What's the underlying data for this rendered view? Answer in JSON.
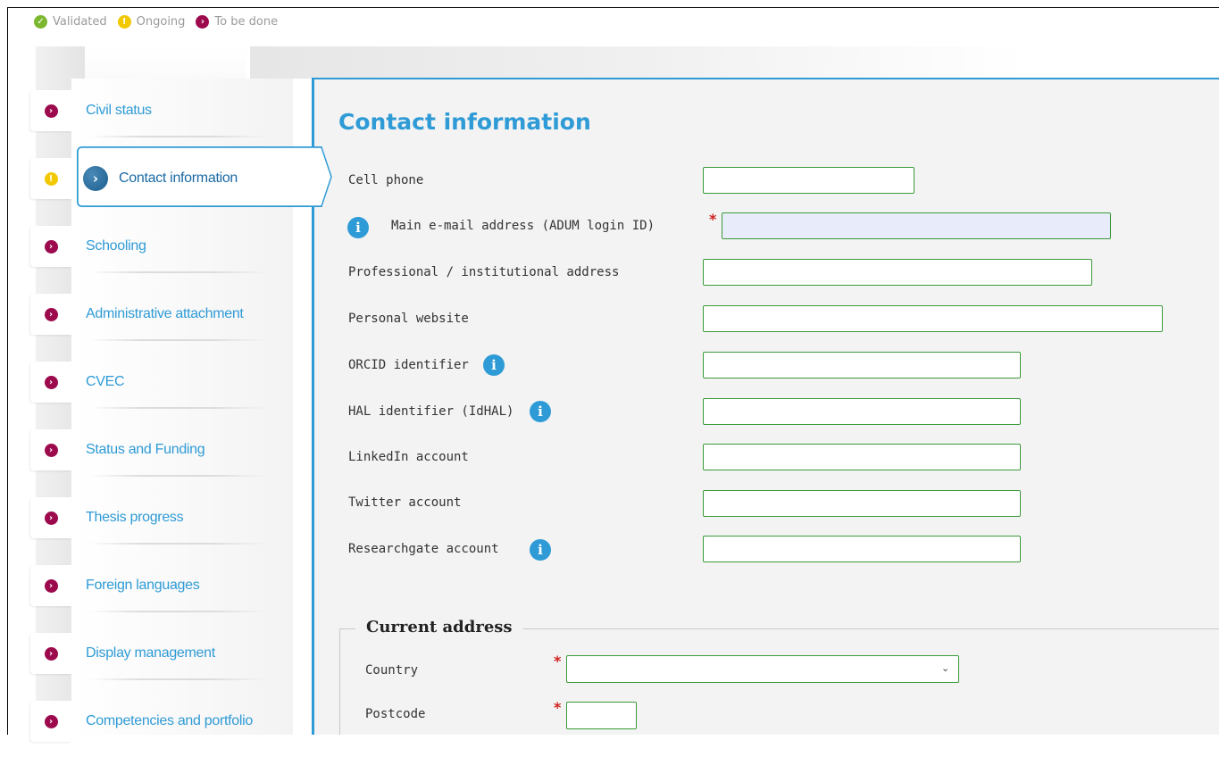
{
  "legend": {
    "validated": "Validated",
    "ongoing": "Ongoing",
    "to_be_done": "To be done"
  },
  "nav": {
    "items": [
      {
        "label": "Civil status",
        "status": "to-be-done"
      },
      {
        "label": "Contact information",
        "status": "ongoing",
        "active": true
      },
      {
        "label": "Schooling",
        "status": "to-be-done"
      },
      {
        "label": "Administrative attachment",
        "status": "to-be-done"
      },
      {
        "label": "CVEC",
        "status": "to-be-done"
      },
      {
        "label": "Status and Funding",
        "status": "to-be-done"
      },
      {
        "label": "Thesis progress",
        "status": "to-be-done"
      },
      {
        "label": "Foreign languages",
        "status": "to-be-done"
      },
      {
        "label": "Display management",
        "status": "to-be-done"
      },
      {
        "label": "Competencies and portfolio",
        "status": "to-be-done"
      }
    ]
  },
  "form": {
    "title": "Contact information",
    "fields": [
      {
        "label": "Cell phone",
        "value": ""
      },
      {
        "label": "Main e-mail address (ADUM login ID)",
        "value": "",
        "required": true,
        "info": true
      },
      {
        "label": "Professional / institutional address",
        "value": ""
      },
      {
        "label": "Personal website",
        "value": ""
      },
      {
        "label": "ORCID identifier",
        "value": "",
        "info": true
      },
      {
        "label": "HAL identifier (IdHAL)",
        "value": "",
        "info": true
      },
      {
        "label": "LinkedIn account",
        "value": ""
      },
      {
        "label": "Twitter account",
        "value": ""
      },
      {
        "label": "Researchgate account",
        "value": "",
        "info": true
      }
    ],
    "address": {
      "legend": "Current address",
      "country_label": "Country",
      "country_value": "",
      "postcode_label": "Postcode",
      "postcode_value": ""
    }
  },
  "colors": {
    "accent": "#2f9bd6",
    "validated": "#7cb82f",
    "ongoing": "#f2c800",
    "to_be_done": "#9c0a4d",
    "field_border": "#3a9a3a",
    "required": "#d02020"
  },
  "icons": {
    "validated": "check-icon",
    "ongoing": "exclamation-icon",
    "to_be_done": "chevron-right-icon",
    "info": "info-icon"
  }
}
